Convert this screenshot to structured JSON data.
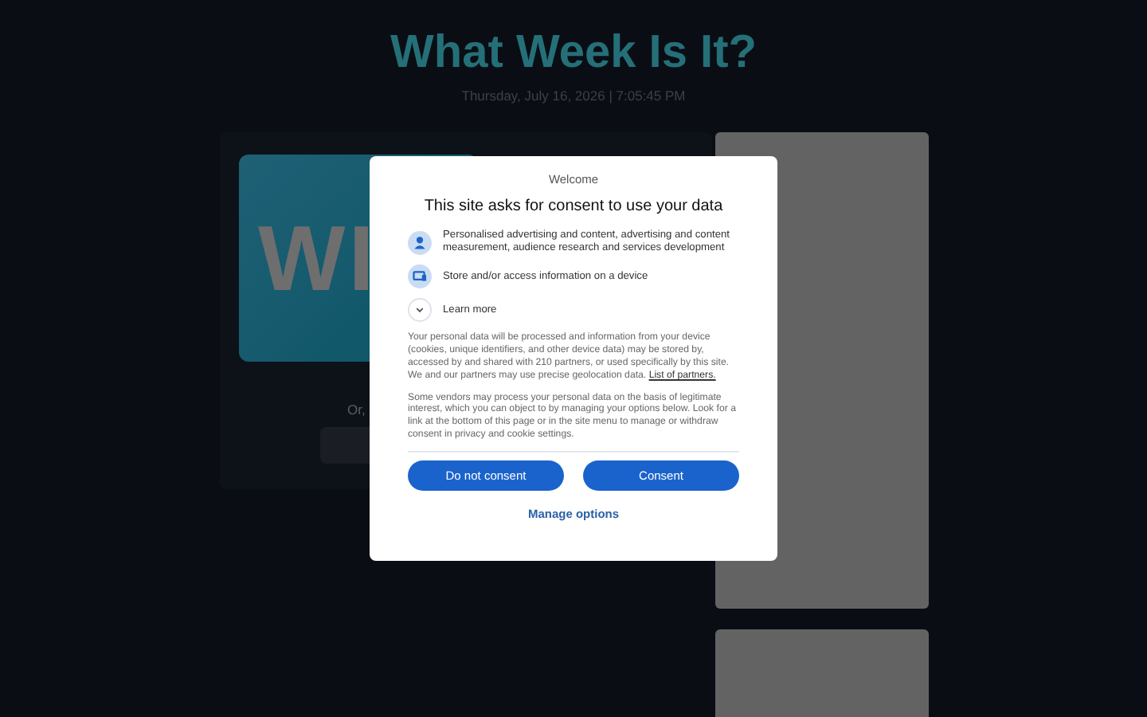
{
  "page": {
    "title": "What Week Is It?",
    "datetime": "Thursday, July 16, 2026 | 7:05:45 PM"
  },
  "week_card": {
    "banner_text": "WI",
    "or_text": "Or,"
  },
  "consent_dialog": {
    "welcome": "Welcome",
    "heading": "This site asks for consent to use your data",
    "purposes": [
      {
        "kind": "person",
        "text": "Personalised advertising and content, advertising and content measurement, audience research and services development"
      },
      {
        "kind": "device",
        "text": "Store and/or access information on a device"
      }
    ],
    "learn_more": {
      "label": "Learn more",
      "expanded": false
    },
    "paragraph_1": "Your personal data will be processed and information from your device (cookies, unique identifiers, and other device data) may be stored by, accessed by and shared with 210 partners, or used specifically by this site. We and our partners may use precise geolocation data.",
    "partners_link": "List of partners.",
    "paragraph_2": "Some vendors may process your personal data on the basis of legitimate interest, which you can object to by managing your options below. Look for a link at the bottom of this page or in the site menu to manage or withdraw consent in privacy and cookie settings.",
    "buttons": [
      "Do not consent",
      "Consent"
    ],
    "manage_link": "Manage options"
  }
}
